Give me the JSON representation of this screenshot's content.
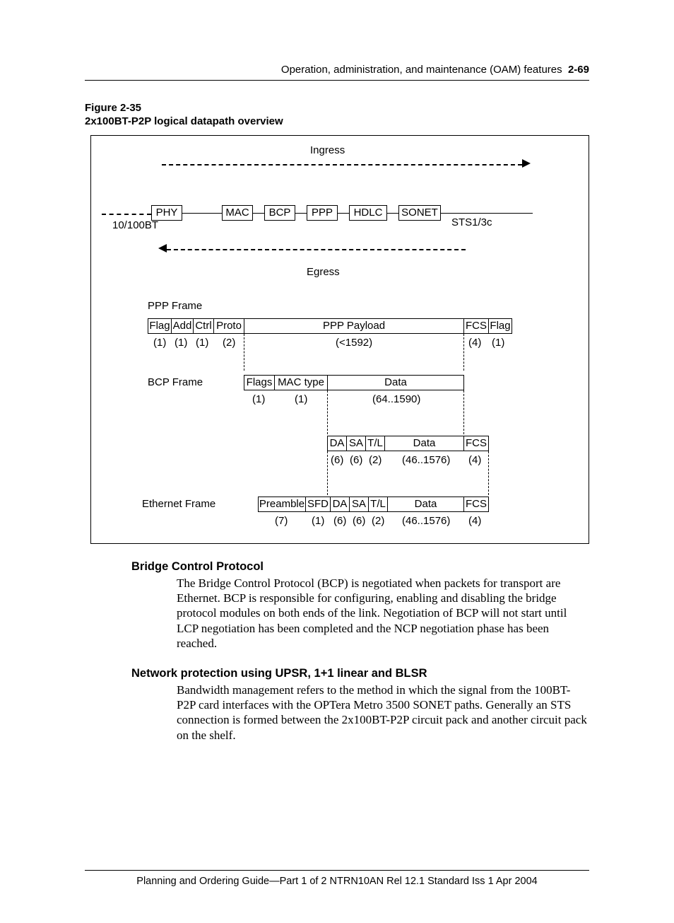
{
  "header": {
    "chapter_title": "Operation, administration, and maintenance (OAM) features",
    "page_number": "2-69"
  },
  "figure": {
    "number": "Figure 2-35",
    "title": "2x100BT-P2P logical datapath overview",
    "flow_labels": {
      "ingress": "Ingress",
      "egress": "Egress",
      "left_interface": "10/100BT",
      "right_interface": "STS1/3c"
    },
    "nodes": [
      "PHY",
      "MAC",
      "BCP",
      "PPP",
      "HDLC",
      "SONET"
    ],
    "frames": {
      "ppp": {
        "label": "PPP Frame",
        "cells": [
          "Flag",
          "Add",
          "Ctrl",
          "Proto",
          "PPP Payload",
          "FCS",
          "Flag"
        ],
        "sizes": [
          "(1)",
          "(1)",
          "(1)",
          "(2)",
          "(<1592)",
          "(4)",
          "(1)"
        ]
      },
      "bcp": {
        "label": "BCP Frame",
        "cells": [
          "Flags",
          "MAC type",
          "Data"
        ],
        "sizes": [
          "(1)",
          "(1)",
          "(64..1590)"
        ]
      },
      "mac_inner": {
        "cells": [
          "DA",
          "SA",
          "T/L",
          "Data",
          "FCS"
        ],
        "sizes": [
          "(6)",
          "(6)",
          "(2)",
          "(46..1576)",
          "(4)"
        ]
      },
      "ethernet": {
        "label": "Ethernet Frame",
        "cells": [
          "Preamble",
          "SFD",
          "DA",
          "SA",
          "T/L",
          "Data",
          "FCS"
        ],
        "sizes": [
          "(7)",
          "(1)",
          "(6)",
          "(6)",
          "(2)",
          "(46..1576)",
          "(4)"
        ]
      }
    }
  },
  "sections": [
    {
      "heading": "Bridge Control Protocol",
      "body": "The Bridge Control Protocol (BCP) is negotiated when packets for transport are Ethernet. BCP is responsible for configuring, enabling and disabling the bridge protocol modules on both ends of the link. Negotiation of BCP will not start until LCP negotiation has been completed and the NCP negotiation phase has been reached."
    },
    {
      "heading": "Network protection using UPSR, 1+1 linear and BLSR",
      "body": "Bandwidth management refers to the method in which the signal from the 100BT-P2P card interfaces with the OPTera Metro 3500 SONET paths. Generally an STS connection is formed between the 2x100BT-P2P circuit pack and another circuit pack on the shelf."
    }
  ],
  "footer": {
    "text": "Planning and Ordering Guide—Part 1 of 2   NTRN10AN   Rel 12.1  Standard   Iss 1   Apr 2004"
  }
}
